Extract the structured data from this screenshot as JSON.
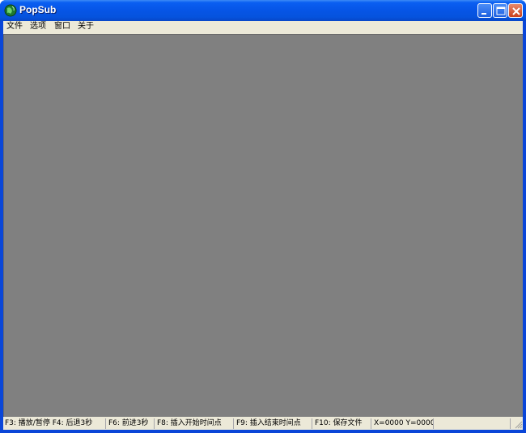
{
  "window": {
    "title": "PopSub"
  },
  "menubar": {
    "items": [
      {
        "label": "文件"
      },
      {
        "label": "选项"
      },
      {
        "label": "窗口"
      },
      {
        "label": "关于"
      }
    ]
  },
  "statusbar": {
    "cells": [
      {
        "text": "F3: 播放/暂停  F4: 后退3秒"
      },
      {
        "text": "F6: 前进3秒"
      },
      {
        "text": "F8: 插入开始时间点"
      },
      {
        "text": "F9: 插入结束时间点"
      },
      {
        "text": "F10: 保存文件"
      },
      {
        "text": "X=0000  Y=0000"
      },
      {
        "text": ""
      }
    ]
  },
  "colors": {
    "titlebar": "#0655e6",
    "workspace": "#808080",
    "chrome": "#ece9d8"
  },
  "icons": {
    "app": "app-globe-icon",
    "minimize": "minimize-icon",
    "maximize": "maximize-icon",
    "close": "close-icon",
    "grip": "resize-grip-icon"
  }
}
